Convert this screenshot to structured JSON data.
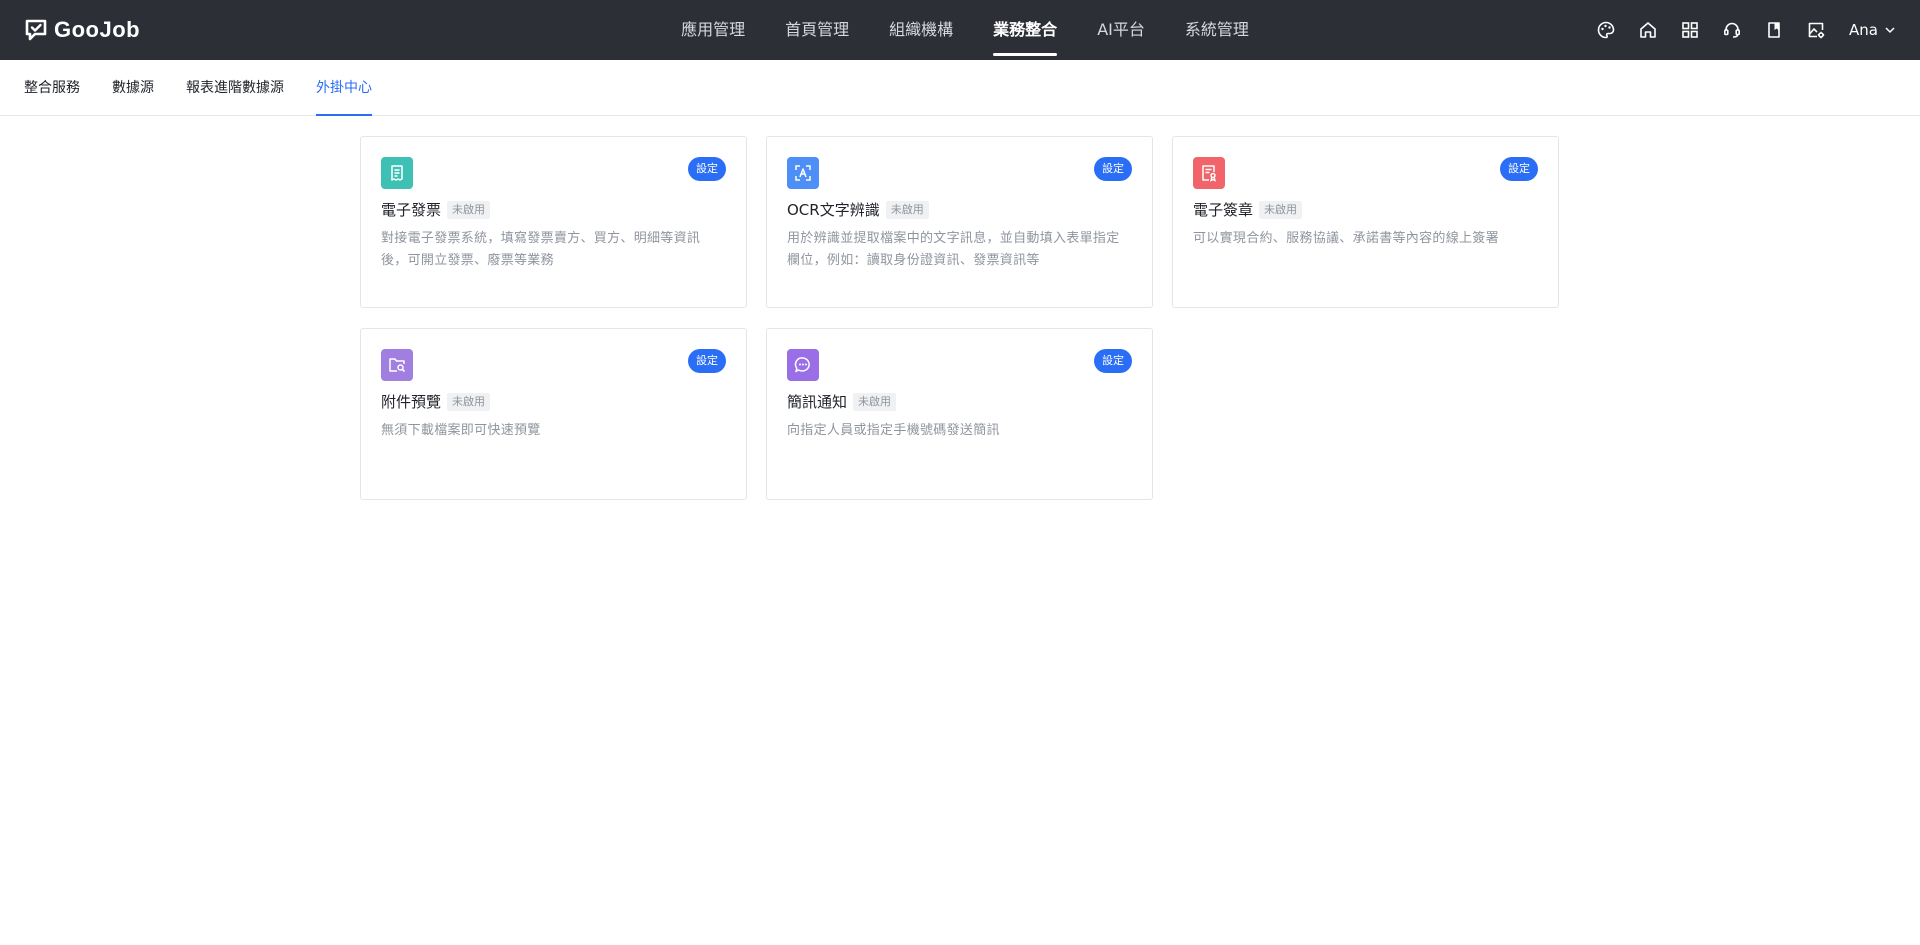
{
  "app": {
    "logo_text": "GooJob"
  },
  "nav": {
    "items": [
      {
        "label": "應用管理"
      },
      {
        "label": "首頁管理"
      },
      {
        "label": "組織機構"
      },
      {
        "label": "業務整合"
      },
      {
        "label": "AI平台"
      },
      {
        "label": "系統管理"
      }
    ],
    "active_index": 3
  },
  "toolbar": {
    "icons": [
      "palette-icon",
      "home-icon",
      "grid-apps-icon",
      "support-headset-icon",
      "bookmark-icon",
      "image-settings-icon"
    ],
    "user_name": "Ana"
  },
  "subnav": {
    "items": [
      {
        "label": "整合服務"
      },
      {
        "label": "數據源"
      },
      {
        "label": "報表進階數據源"
      },
      {
        "label": "外掛中心"
      }
    ],
    "active_index": 3
  },
  "plugins": [
    {
      "title": "電子發票",
      "status": "未啟用",
      "button": "設定",
      "desc": "對接電子發票系統，填寫發票賣方、買方、明細等資訊後，可開立發票、廢票等業務",
      "icon": "invoice-icon",
      "color": "#3ec0b4"
    },
    {
      "title": "OCR文字辨識",
      "status": "未啟用",
      "button": "設定",
      "desc": "用於辨識並提取檔案中的文字訊息，並自動填入表單指定欄位，例如：讀取身份證資訊、發票資訊等",
      "icon": "ocr-scan-icon",
      "color": "#4d8ff7"
    },
    {
      "title": "電子簽章",
      "status": "未啟用",
      "button": "設定",
      "desc": "可以實現合約、服務協議、承諾書等內容的線上簽署",
      "icon": "e-signature-icon",
      "color": "#f0646a"
    },
    {
      "title": "附件預覽",
      "status": "未啟用",
      "button": "設定",
      "desc": "無須下載檔案即可快速預覽",
      "icon": "folder-search-icon",
      "color": "#a17fe0"
    },
    {
      "title": "簡訊通知",
      "status": "未啟用",
      "button": "設定",
      "desc": "向指定人員或指定手機號碼發送簡訊",
      "icon": "message-icon",
      "color": "#9a6ee6"
    }
  ]
}
